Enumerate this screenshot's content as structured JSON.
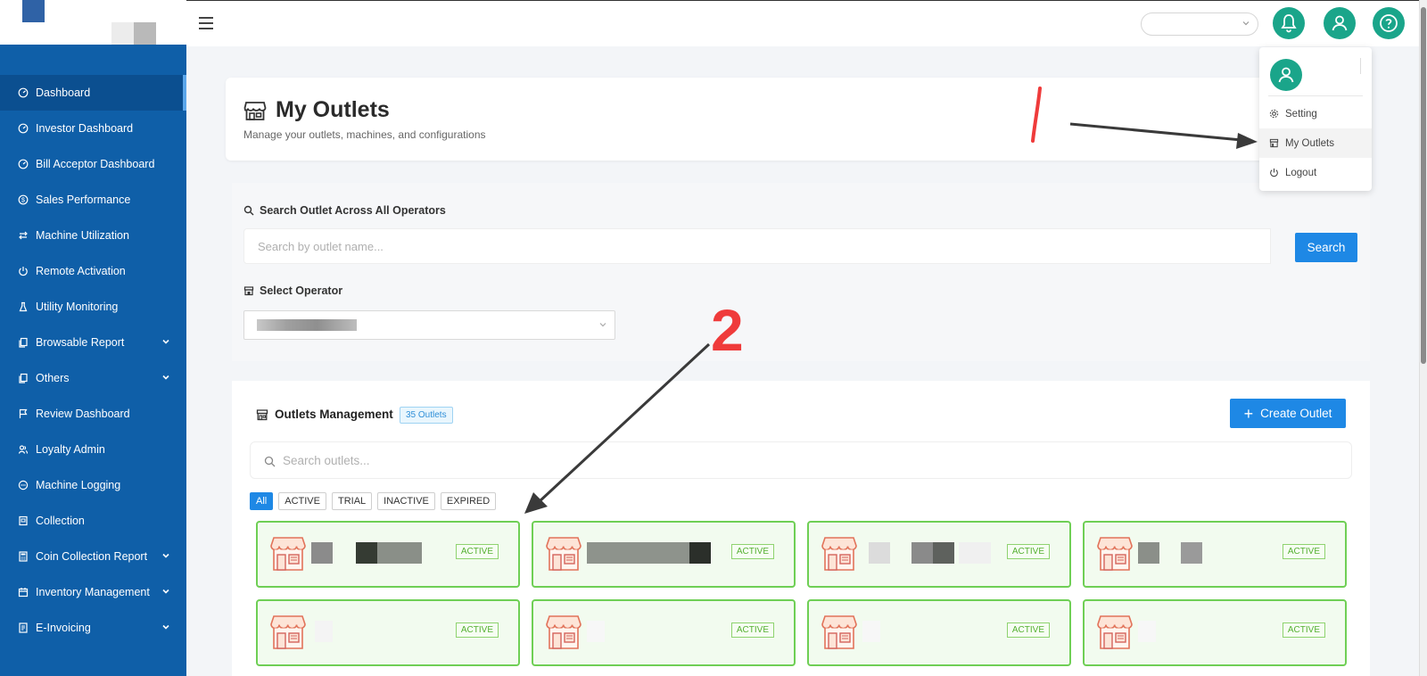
{
  "sidebar": {
    "items": [
      {
        "label": "Dashboard",
        "icon": "gauge-icon",
        "active": true,
        "chevron": false
      },
      {
        "label": "Investor Dashboard",
        "icon": "gauge-icon",
        "chevron": false
      },
      {
        "label": "Bill Acceptor Dashboard",
        "icon": "gauge-icon",
        "chevron": false
      },
      {
        "label": "Sales Performance",
        "icon": "dollar-icon",
        "chevron": false
      },
      {
        "label": "Machine Utilization",
        "icon": "swap-icon",
        "chevron": false
      },
      {
        "label": "Remote Activation",
        "icon": "power-icon",
        "chevron": false
      },
      {
        "label": "Utility Monitoring",
        "icon": "flask-icon",
        "chevron": false
      },
      {
        "label": "Browsable Report",
        "icon": "copy-icon",
        "chevron": true
      },
      {
        "label": "Others",
        "icon": "copy-icon",
        "chevron": true
      },
      {
        "label": "Review Dashboard",
        "icon": "flag-icon",
        "chevron": false
      },
      {
        "label": "Loyalty Admin",
        "icon": "users-icon",
        "chevron": false
      },
      {
        "label": "Machine Logging",
        "icon": "message-icon",
        "chevron": false
      },
      {
        "label": "Collection",
        "icon": "box-icon",
        "chevron": false
      },
      {
        "label": "Coin Collection Report",
        "icon": "calculator-icon",
        "chevron": true
      },
      {
        "label": "Inventory Management",
        "icon": "calendar-icon",
        "chevron": true
      },
      {
        "label": "E-Invoicing",
        "icon": "invoice-icon",
        "chevron": true
      }
    ]
  },
  "topbar": {
    "menu_icon": "hamburger-icon",
    "select_value": "",
    "bell_icon": "bell-icon",
    "user_icon": "user-icon",
    "help_icon": "help-icon",
    "accent": "#1aa58a"
  },
  "profile_menu": {
    "items": [
      {
        "label": "Setting",
        "icon": "gear-icon"
      },
      {
        "label": "My Outlets",
        "icon": "store-icon"
      },
      {
        "label": "Logout",
        "icon": "power-icon"
      }
    ]
  },
  "page": {
    "title": "My Outlets",
    "subtitle": "Manage your outlets, machines, and configurations"
  },
  "search_section": {
    "label": "Search Outlet Across All Operators",
    "placeholder": "Search by outlet name...",
    "button": "Search",
    "operator_label": "Select Operator"
  },
  "management": {
    "title": "Outlets Management",
    "count_badge": "35 Outlets",
    "create_button": "Create Outlet",
    "search_placeholder": "Search outlets...",
    "filters": [
      "All",
      "ACTIVE",
      "TRIAL",
      "INACTIVE",
      "EXPIRED"
    ],
    "active_filter": "All",
    "outlets": [
      {
        "status": "ACTIVE"
      },
      {
        "status": "ACTIVE"
      },
      {
        "status": "ACTIVE"
      },
      {
        "status": "ACTIVE"
      },
      {
        "status": "ACTIVE"
      },
      {
        "status": "ACTIVE"
      },
      {
        "status": "ACTIVE"
      },
      {
        "status": "ACTIVE"
      }
    ]
  },
  "annotations": {
    "marker_1": "1",
    "marker_2": "2",
    "color": "#ef3b3b"
  },
  "colors": {
    "sidebar": "#0f5fa8",
    "primary_button": "#1e88e5",
    "active_border": "#6fcf55"
  }
}
